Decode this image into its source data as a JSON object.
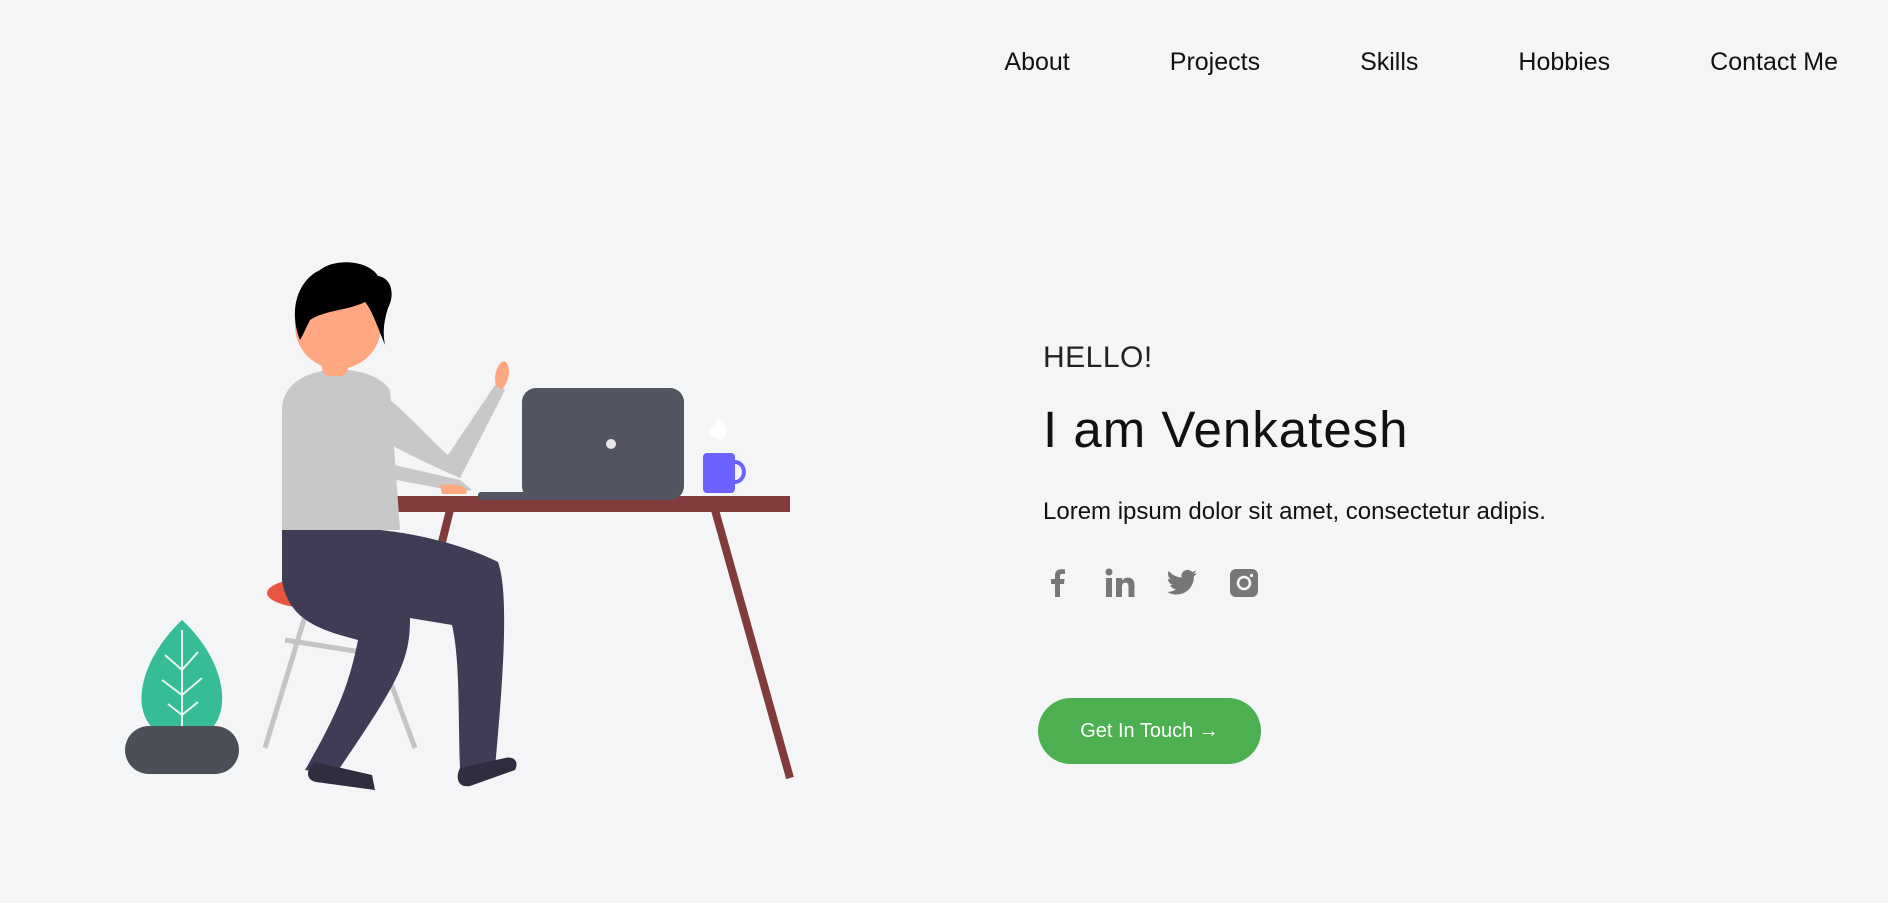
{
  "nav": {
    "items": [
      {
        "label": "About"
      },
      {
        "label": "Projects"
      },
      {
        "label": "Skills"
      },
      {
        "label": "Hobbies"
      },
      {
        "label": "Contact Me"
      }
    ]
  },
  "hero": {
    "greeting": "HELLO!",
    "title": "I am Venkatesh",
    "description": "Lorem ipsum dolor sit amet, consectetur adipis.",
    "cta_label": "Get In Touch →"
  },
  "socials": [
    {
      "icon": "facebook-icon"
    },
    {
      "icon": "linkedin-icon"
    },
    {
      "icon": "twitter-icon"
    },
    {
      "icon": "instagram-icon"
    }
  ],
  "colors": {
    "background": "#f4f5f7",
    "accent": "#4caf50",
    "icon": "#777777"
  }
}
